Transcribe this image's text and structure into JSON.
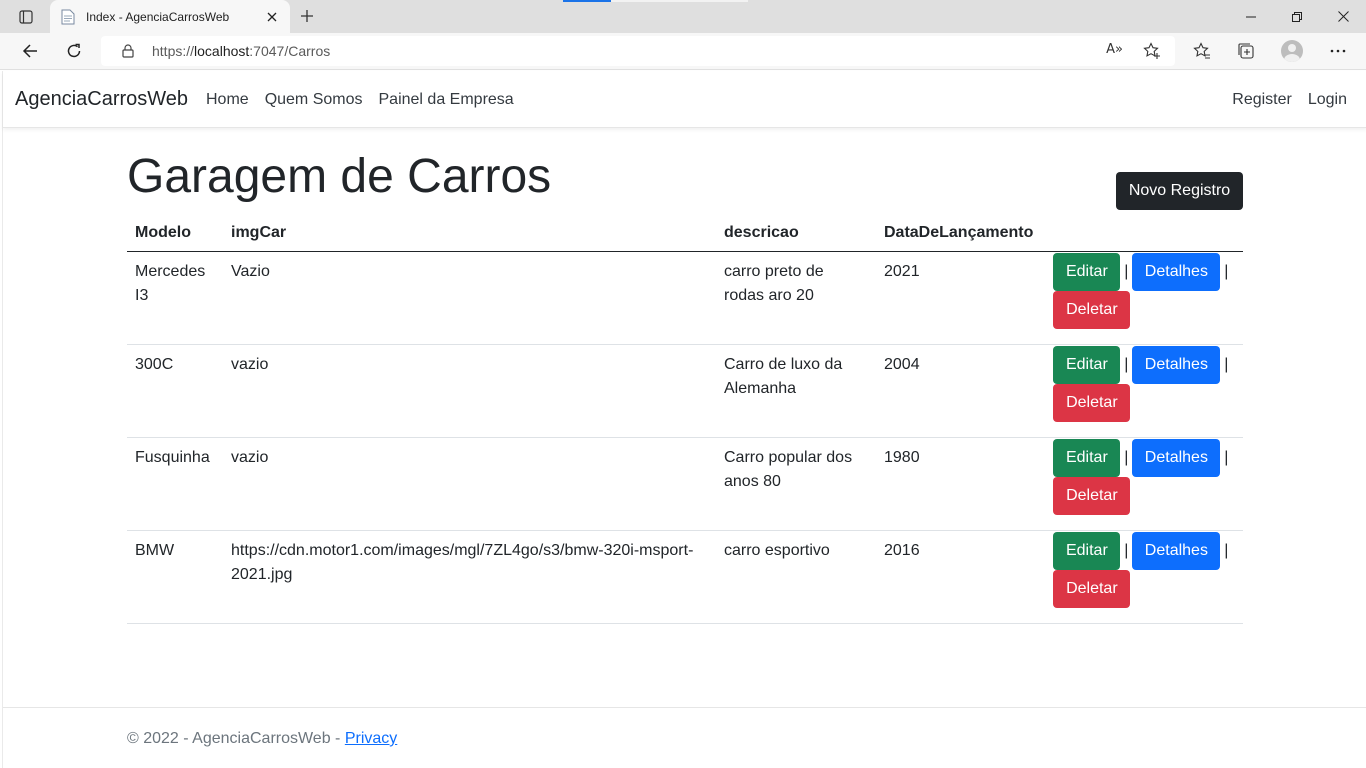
{
  "browser": {
    "tab_title": "Index - AgenciaCarrosWeb",
    "url_prefix": "https://",
    "url_host": "localhost",
    "url_path": ":7047/Carros",
    "read_aloud": "A»"
  },
  "navbar": {
    "brand": "AgenciaCarrosWeb",
    "links": [
      "Home",
      "Quem Somos",
      "Painel da Empresa"
    ],
    "right_links": [
      "Register",
      "Login"
    ]
  },
  "page": {
    "title": "Garagem de Carros",
    "new_button": "Novo Registro"
  },
  "table": {
    "headers": [
      "Modelo",
      "imgCar",
      "descricao",
      "DataDeLançamento"
    ],
    "rows": [
      {
        "modelo": "Mercedes I3",
        "img": "Vazio",
        "descricao": "carro preto de rodas aro 20",
        "data": "2021"
      },
      {
        "modelo": "300C",
        "img": "vazio",
        "descricao": "Carro de luxo da Alemanha",
        "data": "2004"
      },
      {
        "modelo": "Fusquinha",
        "img": "vazio",
        "descricao": "Carro popular dos anos 80",
        "data": "1980"
      },
      {
        "modelo": "BMW",
        "img": "https://cdn.motor1.com/images/mgl/7ZL4go/s3/bmw-320i-msport-2021.jpg",
        "descricao": "carro esportivo",
        "data": "2016"
      }
    ],
    "actions": {
      "edit": "Editar",
      "details": "Detalhes",
      "delete": "Deletar",
      "separator": "|"
    }
  },
  "footer": {
    "text": "© 2022 - AgenciaCarrosWeb - ",
    "privacy": "Privacy"
  },
  "colors": {
    "edit": "#198754",
    "details": "#0d6efd",
    "delete": "#dc3545",
    "dark": "#212529"
  }
}
